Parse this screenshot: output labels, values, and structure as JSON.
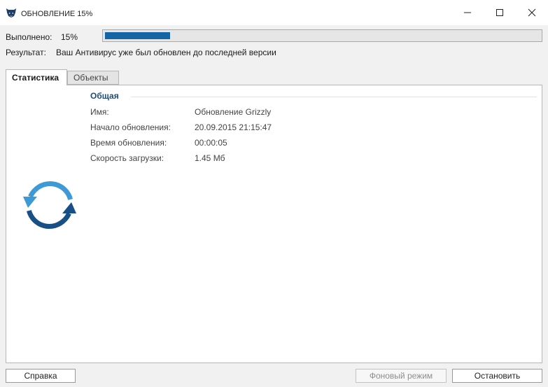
{
  "window": {
    "title": "ОБНОВЛЕНИЕ 15%"
  },
  "status": {
    "progress_label": "Выполнено:",
    "progress_text": "15%",
    "progress_fraction": 0.15,
    "result_label": "Результат:",
    "result_text": "Ваш Антивирус уже был обновлен до последней версии"
  },
  "tabs": [
    {
      "label": "Статистика",
      "active": true
    },
    {
      "label": "Объекты",
      "active": false
    }
  ],
  "stats": {
    "section_title": "Общая",
    "rows": [
      {
        "label": "Имя:",
        "value": "Обновление Grizzly"
      },
      {
        "label": "Начало обновления:",
        "value": "20.09.2015 21:15:47"
      },
      {
        "label": "Время обновления:",
        "value": "00:00:05"
      },
      {
        "label": "Скорость загрузки:",
        "value": "1.45 Мб"
      }
    ]
  },
  "buttons": {
    "help": "Справка",
    "background": "Фоновый режим",
    "stop": "Остановить"
  },
  "icons": {
    "app": "grizzly-bear-logo-icon",
    "refresh": "refresh-arrows-icon"
  },
  "colors": {
    "progress": "#1565a6",
    "section_title": "#1c4b7c",
    "refresh_light": "#3d9ad6",
    "refresh_dark": "#174f86"
  }
}
